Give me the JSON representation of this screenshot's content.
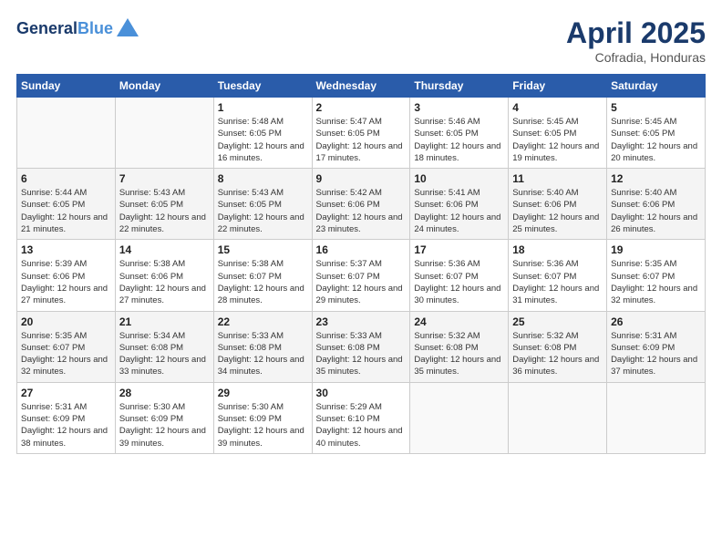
{
  "header": {
    "logo_line1": "General",
    "logo_line2": "Blue",
    "month": "April 2025",
    "location": "Cofradia, Honduras"
  },
  "days_of_week": [
    "Sunday",
    "Monday",
    "Tuesday",
    "Wednesday",
    "Thursday",
    "Friday",
    "Saturday"
  ],
  "weeks": [
    [
      {
        "day": "",
        "sunrise": "",
        "sunset": "",
        "daylight": ""
      },
      {
        "day": "",
        "sunrise": "",
        "sunset": "",
        "daylight": ""
      },
      {
        "day": "1",
        "sunrise": "Sunrise: 5:48 AM",
        "sunset": "Sunset: 6:05 PM",
        "daylight": "Daylight: 12 hours and 16 minutes."
      },
      {
        "day": "2",
        "sunrise": "Sunrise: 5:47 AM",
        "sunset": "Sunset: 6:05 PM",
        "daylight": "Daylight: 12 hours and 17 minutes."
      },
      {
        "day": "3",
        "sunrise": "Sunrise: 5:46 AM",
        "sunset": "Sunset: 6:05 PM",
        "daylight": "Daylight: 12 hours and 18 minutes."
      },
      {
        "day": "4",
        "sunrise": "Sunrise: 5:45 AM",
        "sunset": "Sunset: 6:05 PM",
        "daylight": "Daylight: 12 hours and 19 minutes."
      },
      {
        "day": "5",
        "sunrise": "Sunrise: 5:45 AM",
        "sunset": "Sunset: 6:05 PM",
        "daylight": "Daylight: 12 hours and 20 minutes."
      }
    ],
    [
      {
        "day": "6",
        "sunrise": "Sunrise: 5:44 AM",
        "sunset": "Sunset: 6:05 PM",
        "daylight": "Daylight: 12 hours and 21 minutes."
      },
      {
        "day": "7",
        "sunrise": "Sunrise: 5:43 AM",
        "sunset": "Sunset: 6:05 PM",
        "daylight": "Daylight: 12 hours and 22 minutes."
      },
      {
        "day": "8",
        "sunrise": "Sunrise: 5:43 AM",
        "sunset": "Sunset: 6:05 PM",
        "daylight": "Daylight: 12 hours and 22 minutes."
      },
      {
        "day": "9",
        "sunrise": "Sunrise: 5:42 AM",
        "sunset": "Sunset: 6:06 PM",
        "daylight": "Daylight: 12 hours and 23 minutes."
      },
      {
        "day": "10",
        "sunrise": "Sunrise: 5:41 AM",
        "sunset": "Sunset: 6:06 PM",
        "daylight": "Daylight: 12 hours and 24 minutes."
      },
      {
        "day": "11",
        "sunrise": "Sunrise: 5:40 AM",
        "sunset": "Sunset: 6:06 PM",
        "daylight": "Daylight: 12 hours and 25 minutes."
      },
      {
        "day": "12",
        "sunrise": "Sunrise: 5:40 AM",
        "sunset": "Sunset: 6:06 PM",
        "daylight": "Daylight: 12 hours and 26 minutes."
      }
    ],
    [
      {
        "day": "13",
        "sunrise": "Sunrise: 5:39 AM",
        "sunset": "Sunset: 6:06 PM",
        "daylight": "Daylight: 12 hours and 27 minutes."
      },
      {
        "day": "14",
        "sunrise": "Sunrise: 5:38 AM",
        "sunset": "Sunset: 6:06 PM",
        "daylight": "Daylight: 12 hours and 27 minutes."
      },
      {
        "day": "15",
        "sunrise": "Sunrise: 5:38 AM",
        "sunset": "Sunset: 6:07 PM",
        "daylight": "Daylight: 12 hours and 28 minutes."
      },
      {
        "day": "16",
        "sunrise": "Sunrise: 5:37 AM",
        "sunset": "Sunset: 6:07 PM",
        "daylight": "Daylight: 12 hours and 29 minutes."
      },
      {
        "day": "17",
        "sunrise": "Sunrise: 5:36 AM",
        "sunset": "Sunset: 6:07 PM",
        "daylight": "Daylight: 12 hours and 30 minutes."
      },
      {
        "day": "18",
        "sunrise": "Sunrise: 5:36 AM",
        "sunset": "Sunset: 6:07 PM",
        "daylight": "Daylight: 12 hours and 31 minutes."
      },
      {
        "day": "19",
        "sunrise": "Sunrise: 5:35 AM",
        "sunset": "Sunset: 6:07 PM",
        "daylight": "Daylight: 12 hours and 32 minutes."
      }
    ],
    [
      {
        "day": "20",
        "sunrise": "Sunrise: 5:35 AM",
        "sunset": "Sunset: 6:07 PM",
        "daylight": "Daylight: 12 hours and 32 minutes."
      },
      {
        "day": "21",
        "sunrise": "Sunrise: 5:34 AM",
        "sunset": "Sunset: 6:08 PM",
        "daylight": "Daylight: 12 hours and 33 minutes."
      },
      {
        "day": "22",
        "sunrise": "Sunrise: 5:33 AM",
        "sunset": "Sunset: 6:08 PM",
        "daylight": "Daylight: 12 hours and 34 minutes."
      },
      {
        "day": "23",
        "sunrise": "Sunrise: 5:33 AM",
        "sunset": "Sunset: 6:08 PM",
        "daylight": "Daylight: 12 hours and 35 minutes."
      },
      {
        "day": "24",
        "sunrise": "Sunrise: 5:32 AM",
        "sunset": "Sunset: 6:08 PM",
        "daylight": "Daylight: 12 hours and 35 minutes."
      },
      {
        "day": "25",
        "sunrise": "Sunrise: 5:32 AM",
        "sunset": "Sunset: 6:08 PM",
        "daylight": "Daylight: 12 hours and 36 minutes."
      },
      {
        "day": "26",
        "sunrise": "Sunrise: 5:31 AM",
        "sunset": "Sunset: 6:09 PM",
        "daylight": "Daylight: 12 hours and 37 minutes."
      }
    ],
    [
      {
        "day": "27",
        "sunrise": "Sunrise: 5:31 AM",
        "sunset": "Sunset: 6:09 PM",
        "daylight": "Daylight: 12 hours and 38 minutes."
      },
      {
        "day": "28",
        "sunrise": "Sunrise: 5:30 AM",
        "sunset": "Sunset: 6:09 PM",
        "daylight": "Daylight: 12 hours and 39 minutes."
      },
      {
        "day": "29",
        "sunrise": "Sunrise: 5:30 AM",
        "sunset": "Sunset: 6:09 PM",
        "daylight": "Daylight: 12 hours and 39 minutes."
      },
      {
        "day": "30",
        "sunrise": "Sunrise: 5:29 AM",
        "sunset": "Sunset: 6:10 PM",
        "daylight": "Daylight: 12 hours and 40 minutes."
      },
      {
        "day": "",
        "sunrise": "",
        "sunset": "",
        "daylight": ""
      },
      {
        "day": "",
        "sunrise": "",
        "sunset": "",
        "daylight": ""
      },
      {
        "day": "",
        "sunrise": "",
        "sunset": "",
        "daylight": ""
      }
    ]
  ]
}
